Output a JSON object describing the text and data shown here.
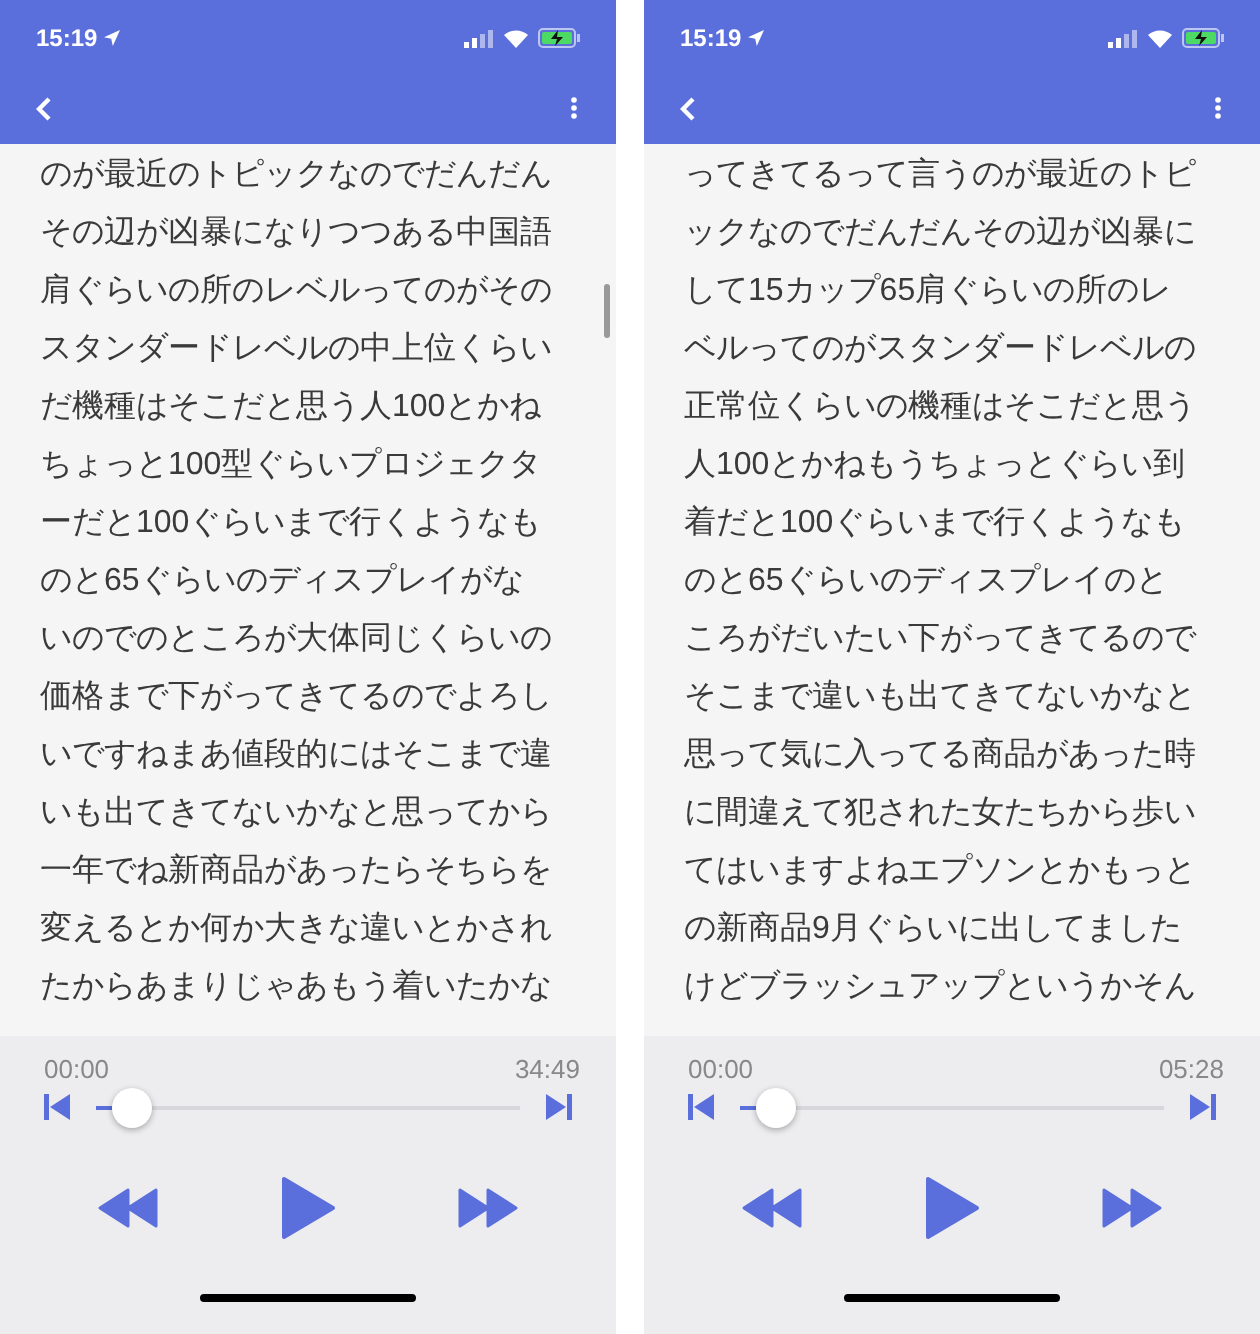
{
  "phones": [
    {
      "status_bar": {
        "time": "15:19"
      },
      "scroll_indicator": true,
      "lines": [
        "のが最近のトピックなのでだんだん",
        "その辺が凶暴になりつつある中国語",
        "肩ぐらいの所のレベルってのがその",
        "スタンダードレベルの中上位くらい",
        "だ機種はそこだと思う人100とかね",
        "ちょっと100型ぐらいプロジェクタ",
        "ーだと100ぐらいまで行くようなも",
        "のと65ぐらいのディスプレイがな",
        "いのでのところが大体同じくらいの",
        "価格まで下がってきてるのでよろし",
        "いですねまあ値段的にはそこまで違",
        "いも出てきてないかなと思ってから",
        "一年でね新商品があったらそちらを",
        "変えるとか何か大きな違いとかされ",
        "たからあまりじゃあもう着いたかな"
      ],
      "player": {
        "elapsed": "00:00",
        "duration": "34:49",
        "level": 0.04
      }
    },
    {
      "status_bar": {
        "time": "15:19"
      },
      "lines": [
        "ってきてるって言うのが最近のトピ",
        "ックなのでだんだんその辺が凶暴に",
        "して15カップ65肩ぐらいの所のレ",
        "ベルってのがスタンダードレベルの",
        "正常位くらいの機種はそこだと思う",
        "人100とかねもうちょっとぐらい到",
        "着だと100ぐらいまで行くようなも",
        "のと65ぐらいのディスプレイのと",
        "ころがだいたい下がってきてるので",
        "そこまで違いも出てきてないかなと",
        "思って気に入ってる商品があった時",
        "に間違えて犯された女たちから歩い",
        "てはいますよねエプソンとかもっと",
        "の新商品9月ぐらいに出してました",
        "けどブラッシュアップというかそん"
      ],
      "player": {
        "elapsed": "00:00",
        "duration": "05:28",
        "level": 0.04
      }
    }
  ]
}
